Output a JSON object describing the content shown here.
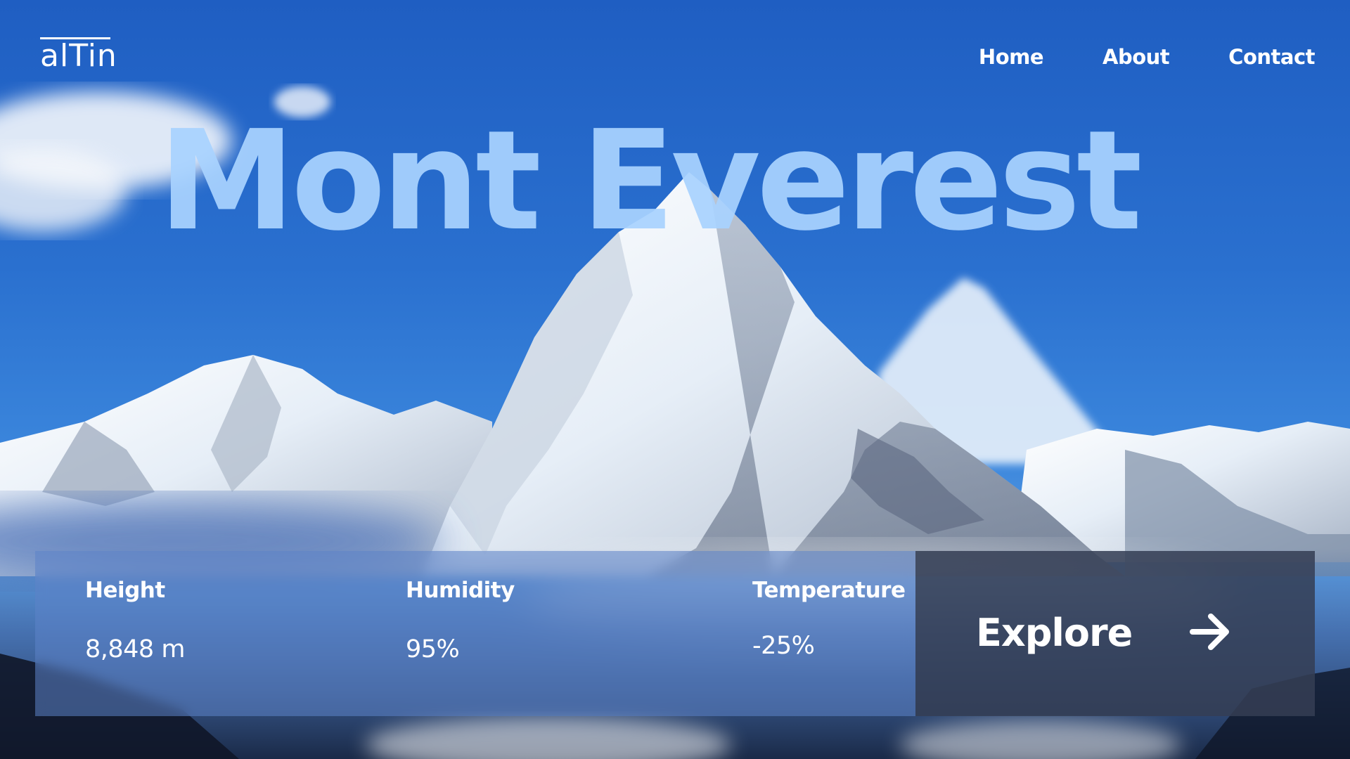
{
  "brand": {
    "logo_text": "alTin"
  },
  "nav": {
    "items": [
      "Home",
      "About",
      "Contact"
    ]
  },
  "hero": {
    "title": "Mont Everest"
  },
  "stats": [
    {
      "label": "Height",
      "value": "8,848 m"
    },
    {
      "label": "Humidity",
      "value": "95%"
    },
    {
      "label": "Temperature",
      "value": "-25%"
    }
  ],
  "cta": {
    "label": "Explore",
    "icon": "arrow-right-icon"
  },
  "colors": {
    "sky": "#2a6ccd",
    "title": "#a9d3ff",
    "stats_panel": "#5c84c8",
    "explore_panel": "#343e54",
    "text": "#ffffff"
  }
}
